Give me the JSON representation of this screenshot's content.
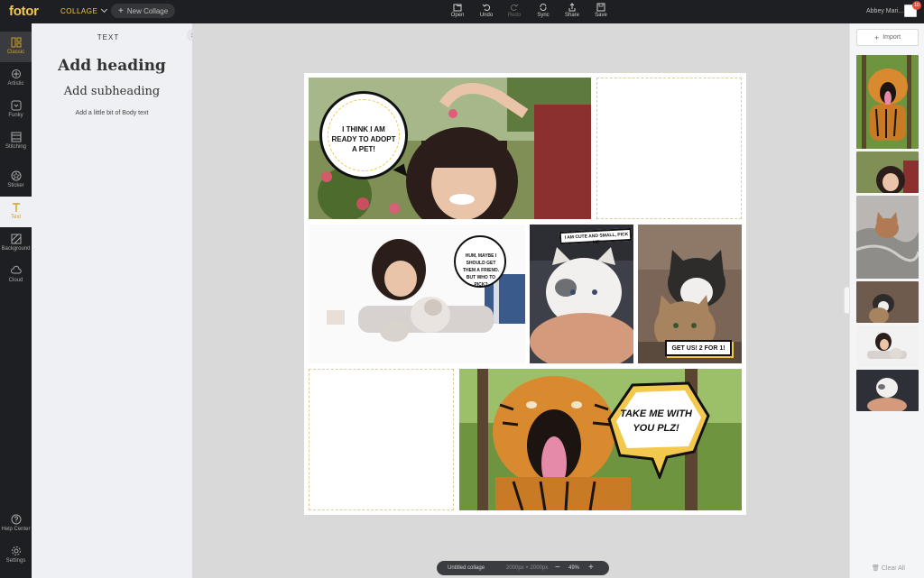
{
  "app": {
    "logo": "fotor",
    "menu_label": "COLLAGE",
    "new_collage_label": "New Collage",
    "user_name": "Abbey Mari...",
    "notification_count": "10"
  },
  "toolbar": {
    "open": "Open",
    "undo": "Undo",
    "redo": "Redo",
    "sync": "Sync",
    "share": "Share",
    "save": "Save"
  },
  "nav": {
    "items": [
      {
        "label": "Classic"
      },
      {
        "label": "Artistic"
      },
      {
        "label": "Funky"
      },
      {
        "label": "Stitching"
      },
      {
        "label": "Sticker"
      },
      {
        "label": "Text"
      },
      {
        "label": "Background"
      },
      {
        "label": "Cloud"
      }
    ],
    "help": "Help Center",
    "settings": "Settings"
  },
  "text_panel": {
    "title": "TEXT",
    "heading": "Add heading",
    "subheading": "Add subheading",
    "body": "Add a little bit of Body text"
  },
  "collage": {
    "bubble1": "I THINK I AM READY TO ADOPT A PET!",
    "bubble2": "HUM, MAYBE I SHOULD GET THEM A FRIEND. BUT WHO TO PICK?",
    "bubble3": "I AM CUTE AND SMALL, PICK ME!",
    "bubble4": "GET US! 2 FOR 1!",
    "bubble5": "TAKE ME WITH YOU PLZ!"
  },
  "status": {
    "name": "Untitled collage",
    "size": "2000px × 2000px",
    "zoom": "49%"
  },
  "sidebar": {
    "import_label": "Import",
    "clear_all": "Clear All"
  },
  "colors": {
    "accent": "#f2c94c",
    "dark": "#1e1f22",
    "panel": "#eef0f4"
  }
}
